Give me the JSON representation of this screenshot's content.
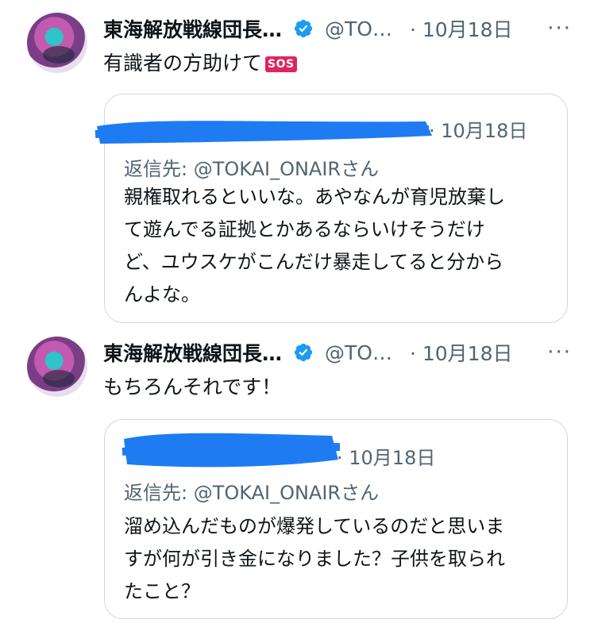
{
  "tweets": [
    {
      "author_name": "東海解放戦線団長…",
      "handle": "@TO…",
      "date": "· 10月18日",
      "more": "···",
      "text": "有識者の方助けて",
      "badge": "SOS",
      "quote": {
        "date": "· 10月18日",
        "reply_to": "返信先: @TOKAI_ONAIRさん",
        "lines": [
          "親権取れるといいな。あやなんが育児放棄し",
          "て遊んでる証拠とかあるならいけそうだけ",
          "ど、ユウスケがこんだけ暴走してると分から",
          "んよな。"
        ]
      }
    },
    {
      "author_name": "東海解放戦線団長…",
      "handle": "@TO…",
      "date": "· 10月18日",
      "more": "···",
      "text": "もちろんそれです！",
      "quote": {
        "date": "· 10月18日",
        "reply_to": "返信先: @TOKAI_ONAIRさん",
        "lines": [
          "溜め込んだものが爆発しているのだと思いま",
          "すが何が引き金になりました？子供を取られ",
          "たこと？"
        ]
      }
    }
  ],
  "colors": {
    "text": "#0f1419",
    "secondary": "#536471",
    "verified": "#1d9bf0",
    "border": "#cfd9de",
    "redaction": "#1e7bf2",
    "sos_badge": "#e0245e"
  },
  "icons": {
    "verified": "verified-badge-icon",
    "more": "more-options-icon"
  }
}
